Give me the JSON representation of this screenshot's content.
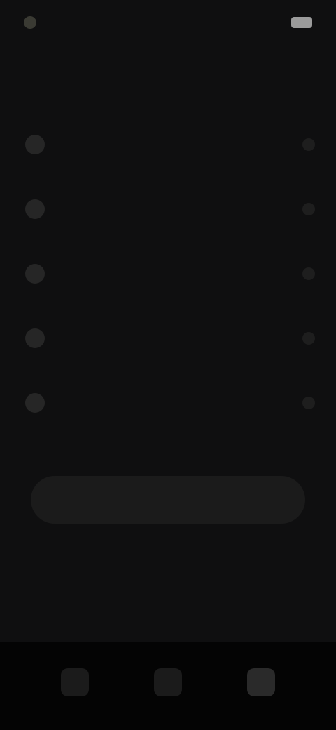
{
  "status": {
    "time": "",
    "battery": ""
  },
  "header": {
    "title": "",
    "subtitle": ""
  },
  "list": {
    "items": [
      {
        "title": "",
        "subtitle": ""
      },
      {
        "title": "",
        "subtitle": ""
      },
      {
        "title": "",
        "subtitle": ""
      },
      {
        "title": "",
        "subtitle": ""
      },
      {
        "title": "",
        "subtitle": ""
      }
    ]
  },
  "section": {
    "title": "",
    "subtitle": "",
    "cta_label": ""
  },
  "bottom": {
    "left_label": "",
    "right_label": ""
  },
  "nav": {
    "items": [
      {
        "label": "",
        "icon": "home-icon"
      },
      {
        "label": "",
        "icon": "info-icon"
      },
      {
        "label": "",
        "icon": "profile-icon"
      }
    ]
  }
}
